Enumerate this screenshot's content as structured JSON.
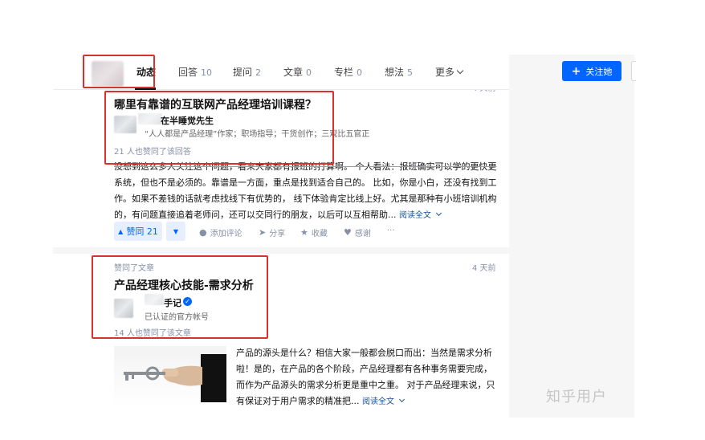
{
  "tabs": [
    {
      "label": "动态",
      "count": ""
    },
    {
      "label": "回答",
      "count": "10"
    },
    {
      "label": "提问",
      "count": "2"
    },
    {
      "label": "文章",
      "count": "0"
    },
    {
      "label": "专栏",
      "count": "0"
    },
    {
      "label": "想法",
      "count": "5"
    },
    {
      "label": "更多",
      "count": ""
    }
  ],
  "follow_button": {
    "label": "关注她"
  },
  "feed": [
    {
      "time": "4 天前",
      "question_title": "哪里有靠谱的互联网产品经理培训课程？",
      "author_name": "在半睡觉先生",
      "author_bio": "“人人都是产品经理”作家；职场指导；干货创作；三观比五官正",
      "liked_note": "21 人也赞同了该回答",
      "excerpt_lines": [
        "没想到这么多人关注这个问题，看来大家都有报班的打算啊。 个人看法：报班确实可以学的更快更",
        "系统，但也不是必须的。靠谱是一方面，重点是找到适合自己的。 比如，你是小白，还没有找到工",
        "作。如果不差钱的话就考虑找线下有优势的， 线下体验肯定比线上好。尤其是那种有小班培训机构",
        "的，有问题直接追着老师问，还可以交同行的朋友，以后可以互相帮助..."
      ],
      "read_more": "阅读全文",
      "vote_label": "赞同 21",
      "actions": [
        "添加评论",
        "分享",
        "收藏",
        "感谢",
        "···"
      ]
    },
    {
      "action_label": "赞同了文章",
      "time": "4 天前",
      "article_title": "产品经理核心技能-需求分析",
      "author_name": "手记",
      "author_bio": "已认证的官方帐号",
      "liked_note": "14 人也赞同了该文章",
      "excerpt_lines": [
        "产品的源头是什么？相信大家一般都会脱口而出：当然是需求分析",
        "啦！是的，在产品的各个阶段，产品经理都有各种事务需要完成，",
        "而作为产品源头的需求分析更是重中之重。 对于产品经理来说，只",
        "有保证对于用户需求的精准把..."
      ],
      "read_more": "阅读全文"
    }
  ],
  "watermark": "知乎用户",
  "colors": {
    "accent": "#0066ff",
    "highlight_box": "#d9322a",
    "link": "#175199"
  }
}
